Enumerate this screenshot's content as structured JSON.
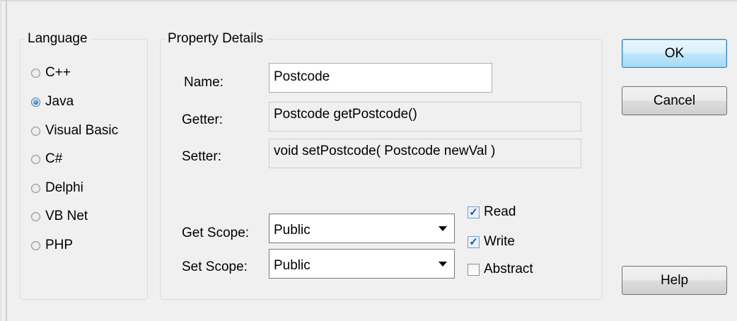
{
  "language_group": {
    "title": "Language",
    "options": [
      {
        "label": "C++",
        "checked": false
      },
      {
        "label": "Java",
        "checked": true
      },
      {
        "label": "Visual Basic",
        "checked": false
      },
      {
        "label": "C#",
        "checked": false
      },
      {
        "label": "Delphi",
        "checked": false
      },
      {
        "label": "VB Net",
        "checked": false
      },
      {
        "label": "PHP",
        "checked": false
      }
    ]
  },
  "property_group": {
    "title": "Property Details",
    "name_label": "Name:",
    "name_value": "Postcode",
    "getter_label": "Getter:",
    "getter_value": "Postcode getPostcode()",
    "setter_label": "Setter:",
    "setter_value": "void setPostcode( Postcode newVal )",
    "get_scope_label": "Get Scope:",
    "get_scope_value": "Public",
    "set_scope_label": "Set Scope:",
    "set_scope_value": "Public",
    "read_label": "Read",
    "read_checked": true,
    "write_label": "Write",
    "write_checked": true,
    "abstract_label": "Abstract",
    "abstract_checked": false
  },
  "buttons": {
    "ok": "OK",
    "cancel": "Cancel",
    "help": "Help"
  },
  "colors": {
    "dialog_bg": "#f0f0f0",
    "default_button_border": "#3c7fb1",
    "check_mark": "#2a4f9e"
  }
}
